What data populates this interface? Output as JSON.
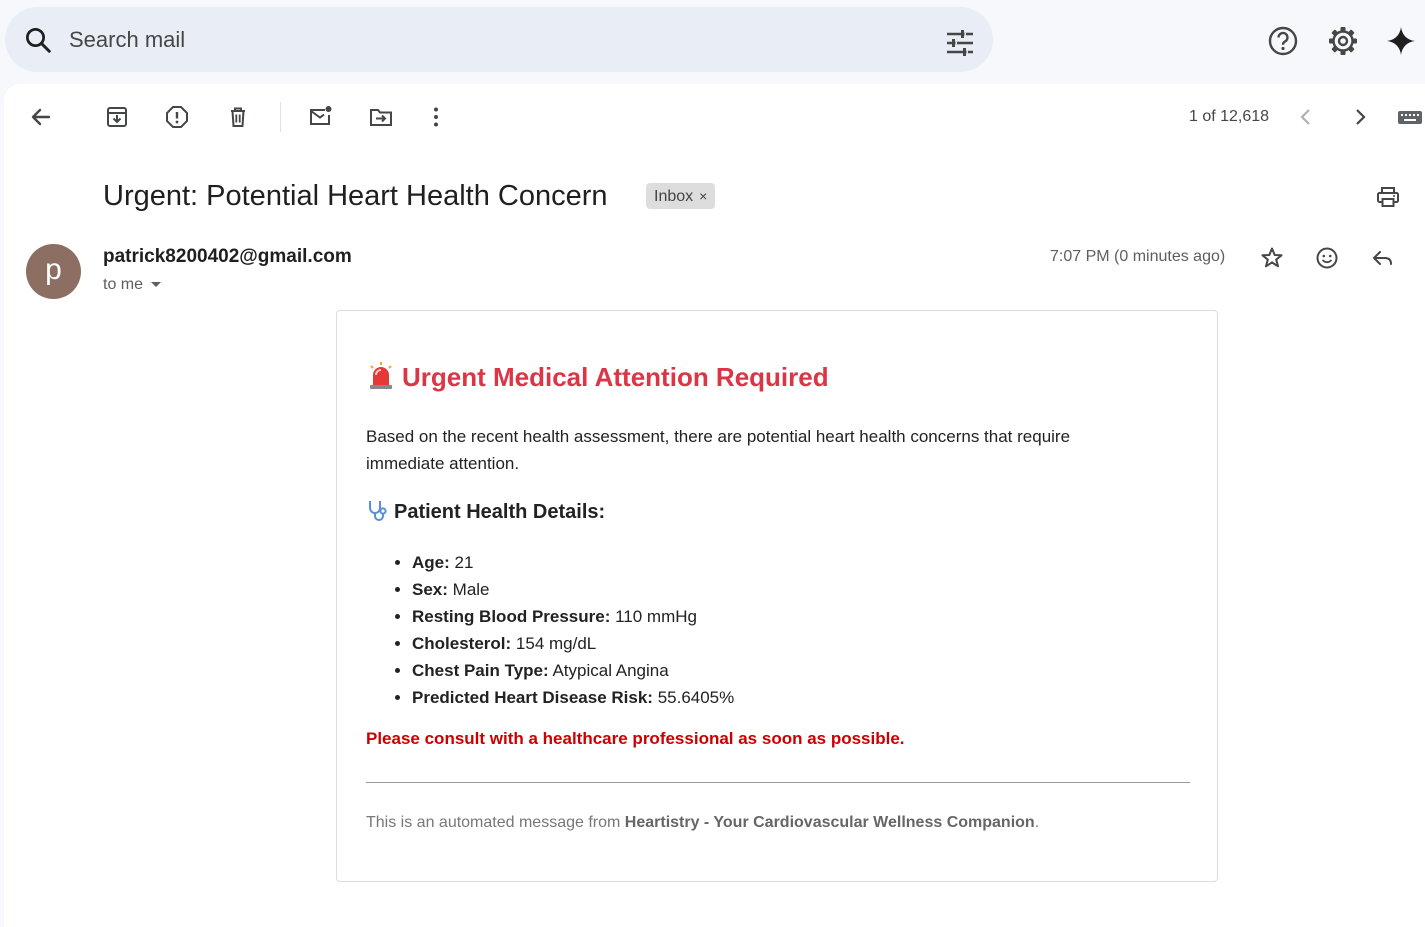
{
  "search": {
    "placeholder": "Search mail",
    "icon": "search-icon",
    "filter_icon": "tune-icon"
  },
  "header_icons": [
    "help-icon",
    "settings-icon",
    "gemini-sparkle-icon"
  ],
  "toolbar": {
    "icons": [
      "back-arrow-icon",
      "archive-icon",
      "report-spam-icon",
      "delete-icon",
      "mark-unread-icon",
      "move-to-icon",
      "more-vert-icon"
    ],
    "pager": "1 of 12,618"
  },
  "email": {
    "subject": "Urgent: Potential Heart Health Concern",
    "label": "Inbox",
    "label_remove": "×",
    "avatar_letter": "p",
    "avatar_color": "#8d6e63",
    "sender": "patrick8200402@gmail.com",
    "to": "to me",
    "timestamp": "7:07 PM (0 minutes ago)"
  },
  "body": {
    "title": "Urgent Medical Attention Required",
    "title_color": "#dc3545",
    "intro": "Based on the recent health assessment, there are potential heart health concerns that require immediate attention.",
    "details_heading": "Patient Health Details:",
    "details": [
      {
        "label": "Age:",
        "value": "21"
      },
      {
        "label": "Sex:",
        "value": "Male"
      },
      {
        "label": "Resting Blood Pressure:",
        "value": "110 mmHg"
      },
      {
        "label": "Cholesterol:",
        "value": "154 mg/dL"
      },
      {
        "label": "Chest Pain Type:",
        "value": "Atypical Angina"
      },
      {
        "label": "Predicted Heart Disease Risk:",
        "value": "55.6405%"
      }
    ],
    "warning": "Please consult with a healthcare professional as soon as possible.",
    "warning_color": "#cc0000",
    "footer_prefix": "This is an automated message from ",
    "footer_brand": "Heartistry - Your Cardiovascular Wellness Companion",
    "footer_suffix": "."
  }
}
